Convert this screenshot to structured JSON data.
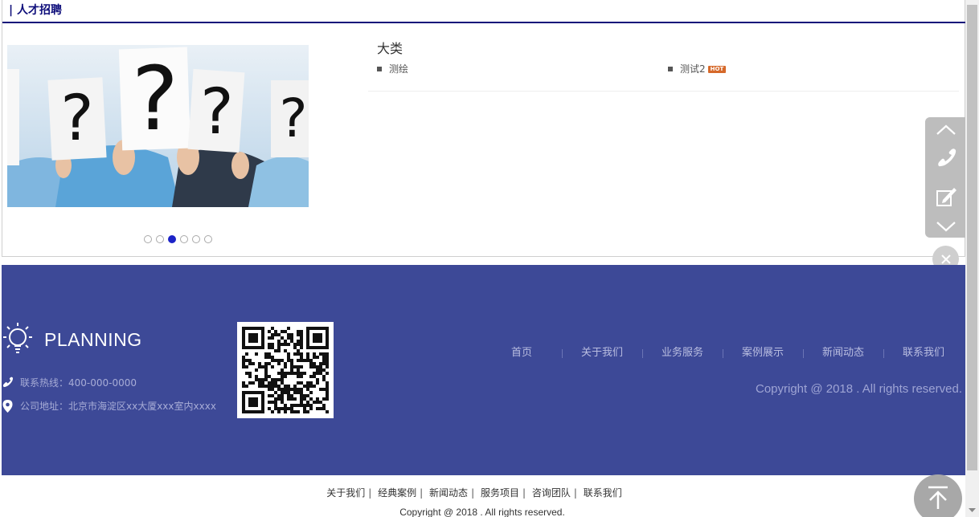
{
  "section": {
    "title": "| 人才招聘"
  },
  "banner": {
    "dots_count": 6,
    "active_index": 2
  },
  "category": {
    "title": "大类",
    "items": [
      {
        "label": "测绘",
        "hot": false
      },
      {
        "label": "测试2",
        "hot": true,
        "badge": "HOT"
      }
    ]
  },
  "footer": {
    "logo_text": "PLANNING",
    "hotline": "联系热线：400-000-0000",
    "address": "公司地址：北京市海淀区xx大厦xxx室内xxxx",
    "nav": [
      "首页",
      "关于我们",
      "业务服务",
      "案例展示",
      "新闻动态",
      "联系我们"
    ],
    "copyright": "Copyright @ 2018 . All rights reserved."
  },
  "bottom": {
    "links": [
      "关于我们",
      "经典案例",
      "新闻动态",
      "服务项目",
      "咨询团队",
      "联系我们"
    ],
    "separator": "|",
    "copyright": "Copyright @ 2018 . All rights reserved."
  },
  "colors": {
    "footer_bg": "#3d4997",
    "title_blue": "#0d0d7a",
    "active_dot": "#1c23c7",
    "hot_badge": "#d6692a",
    "float_bar": "#bdbdbd"
  },
  "icons": [
    "bulb-icon",
    "phone-icon",
    "location-icon",
    "chevron-up-icon",
    "phone-handset-icon",
    "edit-icon",
    "chevron-down-icon",
    "close-icon",
    "arrow-up-icon"
  ]
}
